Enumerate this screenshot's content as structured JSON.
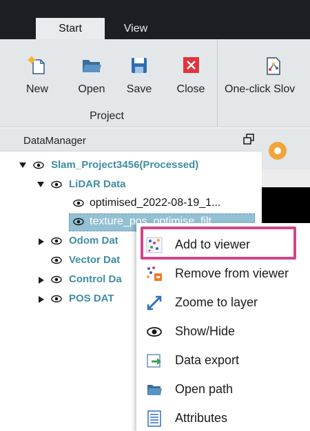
{
  "tabs": [
    {
      "label": "Start",
      "active": true
    },
    {
      "label": "View",
      "active": false
    }
  ],
  "ribbon": {
    "buttons": [
      {
        "label": "New",
        "icon": "new-file-icon"
      },
      {
        "label": "Open",
        "icon": "folder-open-icon"
      },
      {
        "label": "Save",
        "icon": "save-icon"
      },
      {
        "label": "Close",
        "icon": "close-icon"
      }
    ],
    "group_label": "Project",
    "oneclick_label": "One-click Slov"
  },
  "datamanager": {
    "title": "DataManager",
    "tree": [
      {
        "label": "Slam_Project3456(Processed)",
        "expanded": true
      },
      {
        "label": "LiDAR Data",
        "expanded": true
      },
      {
        "label": "optimised_2022-08-19_1..."
      },
      {
        "label": "texture_pos_optimise_filt"
      },
      {
        "label": "Odom Dat",
        "expanded": false
      },
      {
        "label": "Vector Dat"
      },
      {
        "label": "Control Da",
        "expanded": false
      },
      {
        "label": "POS DAT",
        "expanded": false
      }
    ]
  },
  "context_menu": [
    {
      "label": "Add to viewer",
      "icon": "add-to-viewer-icon",
      "highlighted": true
    },
    {
      "label": "Remove from viewer",
      "icon": "remove-from-viewer-icon"
    },
    {
      "label": "Zoome to layer",
      "icon": "zoom-to-layer-icon"
    },
    {
      "label": "Show/Hide",
      "icon": "eye-icon"
    },
    {
      "label": "Data export",
      "icon": "data-export-icon"
    },
    {
      "label": "Open path",
      "icon": "folder-icon"
    },
    {
      "label": "Attributes",
      "icon": "attributes-icon"
    }
  ],
  "colors": {
    "tabbar": "#1b1e22",
    "ribbon": "#e4e7ea",
    "tree_text": "#3e8ea4",
    "selection": "#93c1d3",
    "highlight_border": "#d0458a"
  }
}
